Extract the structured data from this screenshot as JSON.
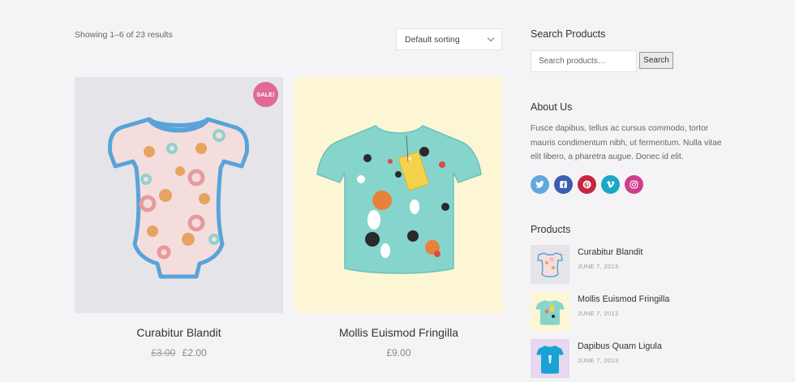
{
  "shop": {
    "result_count": "Showing 1–6 of 23 results",
    "sorting": "Default sorting",
    "products": [
      {
        "name": "Curabitur Blandit",
        "old_price": "£3.00",
        "price": "£2.00",
        "badge": "SALE!",
        "bg_color": "#e5e5e9",
        "image_icon": "baby-bodysuit-image"
      },
      {
        "name": "Mollis Euismod Fringilla",
        "old_price": "",
        "price": "£9.00",
        "bg_color": "#fdf6d5",
        "image_icon": "kids-tshirt-image"
      }
    ]
  },
  "sidebar": {
    "search": {
      "title": "Search Products",
      "placeholder": "Search products…",
      "button": "Search"
    },
    "about": {
      "title": "About Us",
      "text": "Fusce dapibus, tellus ac cursus commodo, tortor mauris condimentum nibh, ut fermentum. Nulla vitae elit libero, a pharetra augue. Donec id elit."
    },
    "socials": [
      {
        "name": "twitter-icon",
        "color": "#5fa9dd"
      },
      {
        "name": "facebook-icon",
        "color": "#3b5db3"
      },
      {
        "name": "pinterest-icon",
        "color": "#c9253f"
      },
      {
        "name": "vimeo-icon",
        "color": "#1aa7c5"
      },
      {
        "name": "instagram-icon",
        "color": "#cf3d8e"
      }
    ],
    "products": {
      "title": "Products",
      "items": [
        {
          "name": "Curabitur Blandit",
          "date": "JUNE 7, 2013"
        },
        {
          "name": "Mollis Euismod Fringilla",
          "date": "JUNE 7, 2013"
        },
        {
          "name": "Dapibus Quam Ligula",
          "date": "JUNE 7, 2013"
        }
      ]
    }
  }
}
